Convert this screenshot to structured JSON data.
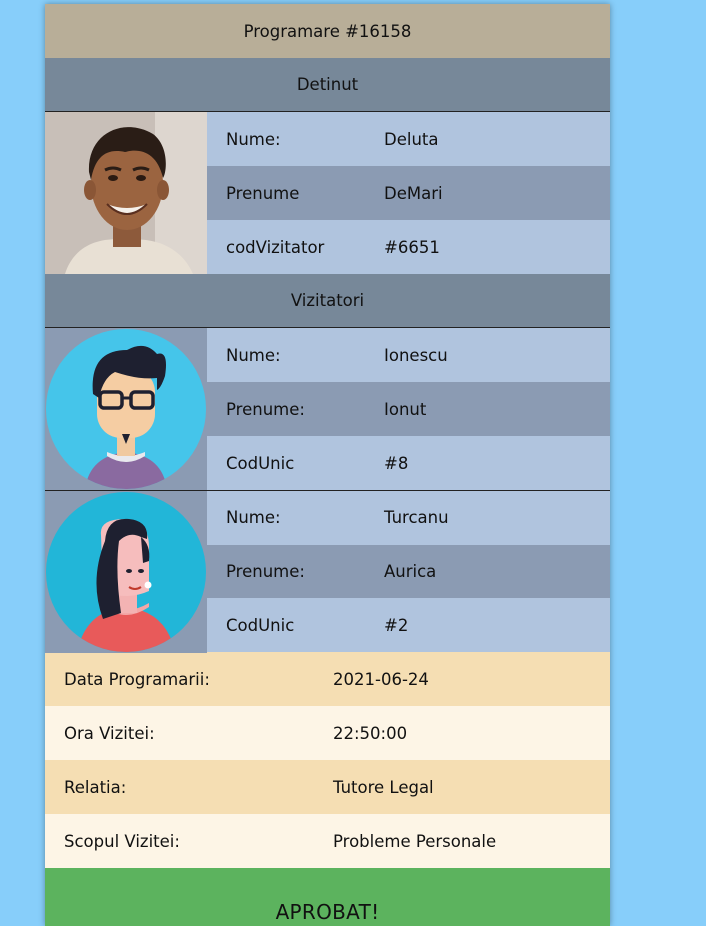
{
  "appointment": {
    "title": "Programare #16158"
  },
  "detainee": {
    "section_title": "Detinut",
    "avatar": "man-photo",
    "fields": [
      {
        "label": "Nume:",
        "value": "Deluta"
      },
      {
        "label": "Prenume",
        "value": "DeMari"
      },
      {
        "label": "codVizitator",
        "value": "#6651"
      }
    ]
  },
  "visitors": {
    "section_title": "Vizitatori",
    "items": [
      {
        "avatar": "man-avatar-icon",
        "fields": [
          {
            "label": "Nume:",
            "value": "Ionescu"
          },
          {
            "label": "Prenume:",
            "value": "Ionut"
          },
          {
            "label": "CodUnic",
            "value": "#8"
          }
        ]
      },
      {
        "avatar": "woman-avatar-icon",
        "fields": [
          {
            "label": "Nume:",
            "value": "Turcanu"
          },
          {
            "label": "Prenume:",
            "value": "Aurica"
          },
          {
            "label": "CodUnic",
            "value": "#2"
          }
        ]
      }
    ]
  },
  "details": [
    {
      "label": "Data Programarii:",
      "value": "2021-06-24"
    },
    {
      "label": "Ora Vizitei:",
      "value": "22:50:00"
    },
    {
      "label": "Relatia:",
      "value": "Tutore Legal"
    },
    {
      "label": "Scopul Vizitei:",
      "value": "Probleme Personale"
    }
  ],
  "status": {
    "label": "APROBAT!",
    "color": "#5cb35e"
  },
  "colors": {
    "background": "#87cefa",
    "title_bar": "#b8ae98",
    "section": "#778899",
    "row_light": "#b0c4de",
    "row_dark": "#8b9bb3",
    "detail_1": "#f5deb3",
    "detail_2": "#fdf5e6"
  }
}
